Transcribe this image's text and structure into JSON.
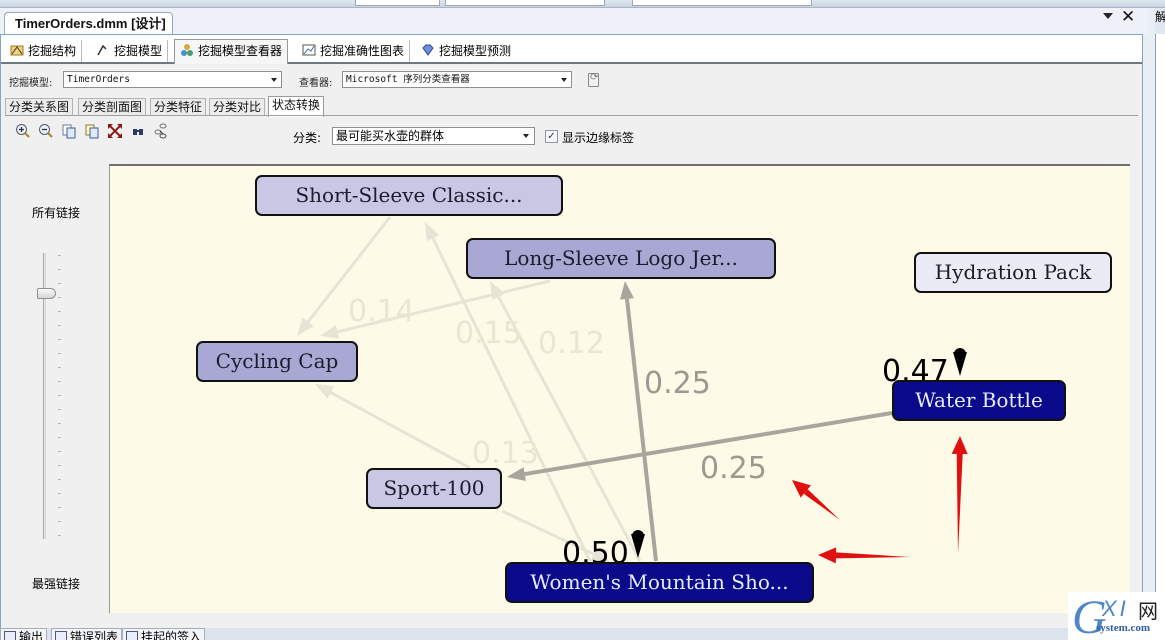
{
  "document": {
    "tab_title": "TimerOrders.dmm [设计]"
  },
  "designer_tabs": [
    {
      "label": "挖掘结构",
      "icon": "mining-structure-icon"
    },
    {
      "label": "挖掘模型",
      "icon": "mining-model-icon"
    },
    {
      "label": "挖掘模型查看器",
      "icon": "model-viewer-icon",
      "active": true
    },
    {
      "label": "挖掘准确性图表",
      "icon": "accuracy-chart-icon"
    },
    {
      "label": "挖掘模型预测",
      "icon": "prediction-icon"
    }
  ],
  "model_bar": {
    "model_label": "挖掘模型:",
    "model_value": "TimerOrders",
    "viewer_label": "查看器:",
    "viewer_value": "Microsoft 序列分类查看器"
  },
  "viewer_tabs": [
    {
      "label": "分类关系图"
    },
    {
      "label": "分类剖面图"
    },
    {
      "label": "分类特征"
    },
    {
      "label": "分类对比"
    },
    {
      "label": "状态转换",
      "active": true
    }
  ],
  "toolbar": {
    "icons": [
      "zoom-in-icon",
      "zoom-out-icon",
      "copy-icon",
      "copy-graph-view-icon",
      "fit-to-window-icon",
      "find-node-icon",
      "layout-icon"
    ],
    "cluster_label": "分类:",
    "cluster_value": "最可能买水壶的群体",
    "show_edge_labels_label": "显示边缘标签",
    "show_edge_labels_checked": true
  },
  "slider": {
    "top_label": "所有链接",
    "bottom_label": "最强链接",
    "value_fraction_from_top": 0.14
  },
  "graph": {
    "nodes": [
      {
        "id": "short-sleeve",
        "label": "Short-Sleeve Classic...",
        "style": "light"
      },
      {
        "id": "long-sleeve",
        "label": "Long-Sleeve Logo Jer...",
        "style": "medium"
      },
      {
        "id": "hydration-pack",
        "label": "Hydration Pack",
        "style": "pale"
      },
      {
        "id": "cycling-cap",
        "label": "Cycling Cap",
        "style": "medium"
      },
      {
        "id": "water-bottle",
        "label": "Water Bottle",
        "style": "dark"
      },
      {
        "id": "sport-100",
        "label": "Sport-100",
        "style": "light"
      },
      {
        "id": "womens-mountain",
        "label": "Women's Mountain Sho...",
        "style": "dark"
      }
    ],
    "edges": [
      {
        "from": "long-sleeve",
        "to": "cycling-cap",
        "label": "0.14",
        "strength": "faint"
      },
      {
        "from": "short-sleeve",
        "to": "cycling-cap",
        "label": "",
        "strength": "faint"
      },
      {
        "from": "womens-mountain",
        "to": "short-sleeve",
        "label": "0.15",
        "strength": "faint"
      },
      {
        "from": "womens-mountain",
        "to": "short-sleeve",
        "label": "0.12",
        "strength": "faint"
      },
      {
        "from": "womens-mountain",
        "to": "long-sleeve",
        "label": "0.25",
        "strength": "strong"
      },
      {
        "from": "water-bottle",
        "to": "sport-100",
        "label": "0.25",
        "strength": "strong"
      },
      {
        "from": "sport-100",
        "to": "cycling-cap",
        "label": "0.13",
        "strength": "faint"
      },
      {
        "from": "womens-mountain",
        "to": "sport-100",
        "label": "",
        "strength": "faint"
      }
    ],
    "self_loops": [
      {
        "node": "water-bottle",
        "label": "0.47"
      },
      {
        "node": "womens-mountain",
        "label": "0.50"
      }
    ],
    "colors": {
      "background": "#fdfbe8",
      "node_dark": "#0a0a8a",
      "node_medium": "#a9a8d4",
      "node_light": "#c9c8e4",
      "node_pale": "#ebebf6",
      "edge_strong": "#a8a69c",
      "edge_faint": "#e6e4d4",
      "annotation_arrow": "#e01010"
    }
  },
  "bottom_tabs": [
    {
      "label": "输出"
    },
    {
      "label": "错误列表"
    },
    {
      "label": "挂起的签入"
    }
  ],
  "right_panel": {
    "header": "解"
  },
  "watermark": {
    "brand": "GXI网",
    "domain": "system.com"
  }
}
